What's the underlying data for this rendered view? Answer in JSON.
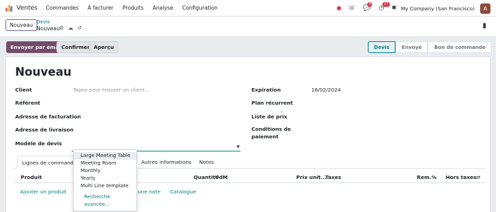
{
  "navbar": {
    "app_name": "Ventes",
    "menu": [
      "Commandes",
      "À facturer",
      "Produits",
      "Analyse",
      "Configuration"
    ],
    "messages_badge": "5",
    "activities_badge": "27",
    "company": "My Company (San Francisco)",
    "avatar_initial": "A"
  },
  "breadcrumb": {
    "new_button": "Nouveau",
    "parent": "Devis",
    "current": "Nouveau"
  },
  "actions": {
    "send_email": "Envoyer par email",
    "confirm": "Confirmer",
    "preview": "Aperçu"
  },
  "status": {
    "stages": [
      "Devis",
      "Envoyé",
      "Bon de commande"
    ],
    "active": "Devis"
  },
  "form": {
    "title": "Nouveau",
    "client_label": "Client",
    "client_placeholder": "Tapez pour trouver un client...",
    "reference_label": "Référent",
    "billing_label": "Adresse de facturation",
    "delivery_label": "Adresse de livraison",
    "template_label": "Modèle de devis",
    "expiration_label": "Expiration",
    "expiration_value": "16/02/2024",
    "recurring_label": "Plan récurrent",
    "pricelist_label": "Liste de prix",
    "pricelist_help": "?",
    "payment_terms_label_1": "Conditions de",
    "payment_terms_label_2": "paiement"
  },
  "tabs": [
    "Lignes de commande",
    "Autres informations",
    "Notes"
  ],
  "table": {
    "columns": [
      "Produit",
      "Quantité",
      "UdM",
      "Prix unit...",
      "Taxes",
      "Rem.%",
      "Hors taxes"
    ],
    "add_product": "Ajouter un produit",
    "add_note": "une note",
    "catalog": "Catalogue"
  },
  "dropdown": {
    "items": [
      "Large Meeting Table",
      "Meeting Room",
      "Monthly",
      "Yearly",
      "Multi Line template"
    ],
    "highlighted": "Large Meeting Table",
    "search_more": "Recherche avancée..."
  },
  "colors": {
    "primary": "#714b67",
    "accent": "#017e84",
    "badge": "#dc3545"
  }
}
